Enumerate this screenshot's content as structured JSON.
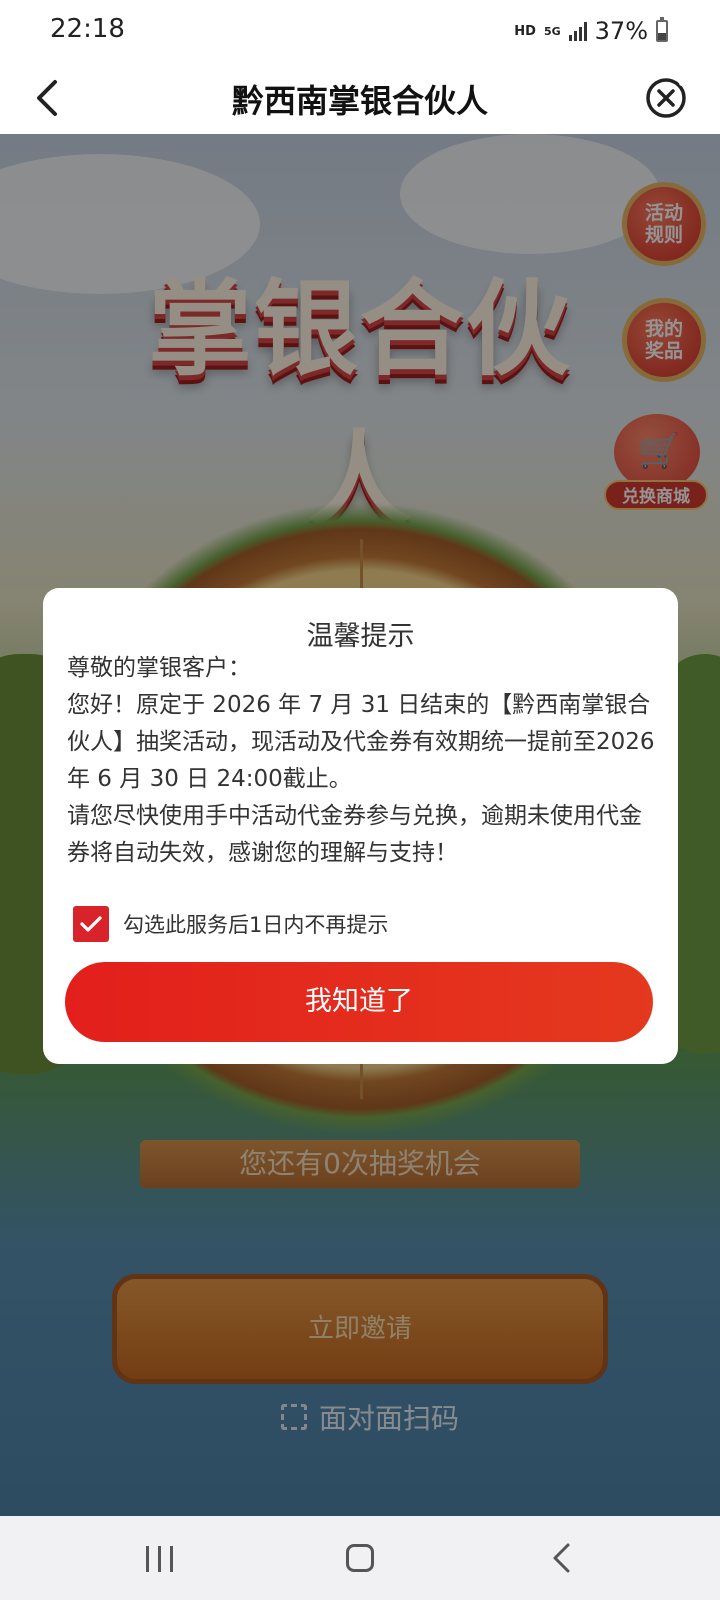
{
  "status_bar": {
    "time": "22:18",
    "hd": "HD",
    "network": "5G",
    "battery": "37%"
  },
  "header": {
    "title": "黔西南掌银合伙人",
    "back_icon": "chevron-left-icon",
    "close_icon": "close-circle-icon"
  },
  "game": {
    "banner_title": "掌银合伙人",
    "side_buttons": {
      "rules": "活动\n规则",
      "prizes": "我的\n奖品",
      "shop": "兑换商城"
    },
    "chances_text": "您还有0次抽奖机会",
    "invite_button": "立即邀请",
    "scan_button": "面对面扫码"
  },
  "dialog": {
    "title": "温馨提示",
    "greeting": "尊敬的掌银客户：",
    "paragraph1": "您好！原定于 2026 年 7 月 31 日结束的【黔西南掌银合伙人】抽奖活动，现活动及代金券有效期统一提前至2026 年 6 月 30 日 24:00截止。",
    "paragraph2": "请您尽快使用手中活动代金券参与兑换，逾期未使用代金券将自动失效，感谢您的理解与支持！",
    "checkbox_label": "勾选此服务后1日内不再提示",
    "checkbox_checked": true,
    "confirm_button": "我知道了",
    "accent_color": "#e31f1c"
  }
}
